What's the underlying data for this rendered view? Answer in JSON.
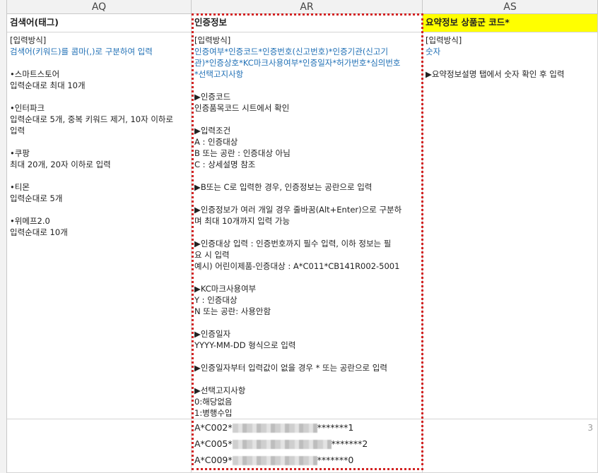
{
  "columns": {
    "aq": "AQ",
    "ar": "AR",
    "as": "AS"
  },
  "header_row": {
    "aq": "검색어(태그)",
    "ar": "인증정보",
    "as": "요약정보 상품군 코드*"
  },
  "aq_body": [
    {
      "text": "[입력방식]",
      "style": "normal"
    },
    {
      "text": "검색어(키워드)를 콤마(,)로 구분하여 입력",
      "style": "blue"
    },
    {
      "text": "",
      "style": "gap"
    },
    {
      "text": "•스마트스토어",
      "style": "normal"
    },
    {
      "text": "입력순대로 최대 10개",
      "style": "normal"
    },
    {
      "text": "",
      "style": "gap"
    },
    {
      "text": "•인터파크",
      "style": "normal"
    },
    {
      "text": "입력순대로 5개, 중복 키워드 제거, 10자 이하로",
      "style": "normal"
    },
    {
      "text": "입력",
      "style": "normal"
    },
    {
      "text": "",
      "style": "gap"
    },
    {
      "text": "•쿠팡",
      "style": "normal"
    },
    {
      "text": "최대 20개, 20자 이하로 입력",
      "style": "normal"
    },
    {
      "text": "",
      "style": "gap"
    },
    {
      "text": "•티몬",
      "style": "normal"
    },
    {
      "text": "입력순대로 5개",
      "style": "normal"
    },
    {
      "text": "",
      "style": "gap"
    },
    {
      "text": "•위메프2.0",
      "style": "normal"
    },
    {
      "text": "입력순대로 10개",
      "style": "normal"
    }
  ],
  "ar_body": [
    {
      "text": "[입력방식]",
      "style": "normal"
    },
    {
      "text": "인증여부*인증코드*인증번호(신고번호)*인증기관(신고기",
      "style": "blue"
    },
    {
      "text": "관)*인증상호*KC마크사용여부*인증일자*허가번호*심의번호",
      "style": "blue"
    },
    {
      "text": "*선택고지사항",
      "style": "blue"
    },
    {
      "text": "",
      "style": "gap"
    },
    {
      "text": "▶인증코드",
      "style": "normal"
    },
    {
      "text": "인증품목코드 시트에서 확인",
      "style": "normal"
    },
    {
      "text": "",
      "style": "gap"
    },
    {
      "text": "▶입력조건",
      "style": "normal"
    },
    {
      "text": "A : 인증대상",
      "style": "normal"
    },
    {
      "text": "B 또는 공란 : 인증대상 아님",
      "style": "normal"
    },
    {
      "text": "C : 상세설명 참조",
      "style": "normal"
    },
    {
      "text": "",
      "style": "gap"
    },
    {
      "text": "▶B또는 C로 입력한 경우, 인증정보는 공란으로 입력",
      "style": "normal"
    },
    {
      "text": "",
      "style": "gap"
    },
    {
      "text": "▶인증정보가 여러 개일 경우 줄바꿈(Alt+Enter)으로 구분하",
      "style": "normal"
    },
    {
      "text": "며 최대 10개까지 입력 가능",
      "style": "normal"
    },
    {
      "text": "",
      "style": "gap"
    },
    {
      "text": "▶인증대상 입력 : 인증번호까지 필수 입력, 이하 정보는 필",
      "style": "normal"
    },
    {
      "text": "요 시 입력",
      "style": "normal"
    },
    {
      "text": "예시) 어린이제품-인증대상 : A*C011*CB141R002-5001",
      "style": "normal"
    },
    {
      "text": "",
      "style": "gap"
    },
    {
      "text": "▶KC마크사용여부",
      "style": "normal"
    },
    {
      "text": "Y : 인증대상",
      "style": "normal"
    },
    {
      "text": "N 또는 공란: 사용안함",
      "style": "normal"
    },
    {
      "text": "",
      "style": "gap"
    },
    {
      "text": "▶인증일자",
      "style": "normal"
    },
    {
      "text": "YYYY-MM-DD 형식으로 입력",
      "style": "normal"
    },
    {
      "text": "",
      "style": "gap"
    },
    {
      "text": "▶인증일자부터 입력값이 없을 경우 * 또는 공란으로 입력",
      "style": "normal"
    },
    {
      "text": "",
      "style": "gap"
    },
    {
      "text": "▶선택고지사항",
      "style": "normal"
    },
    {
      "text": "0:해당없음",
      "style": "normal"
    },
    {
      "text": "1:병행수입",
      "style": "normal"
    }
  ],
  "as_body": [
    {
      "text": "[입력방식]",
      "style": "normal"
    },
    {
      "text": "숫자",
      "style": "blue"
    },
    {
      "text": "",
      "style": "gap"
    },
    {
      "text": "▶요약정보설명 탭에서 숫자 확인 후 입력",
      "style": "normal"
    }
  ],
  "data_row": {
    "ar_lines": [
      {
        "prefix": "A*C002*",
        "suffix": "*******1"
      },
      {
        "prefix": "A*C005*",
        "suffix": "*******2"
      },
      {
        "prefix": "A*C009*",
        "suffix": "*******0"
      }
    ],
    "as_value": "3"
  },
  "colors": {
    "header_yellow": "#ffff00",
    "blue_text": "#1f6fb5",
    "selection_red": "#d32323"
  }
}
